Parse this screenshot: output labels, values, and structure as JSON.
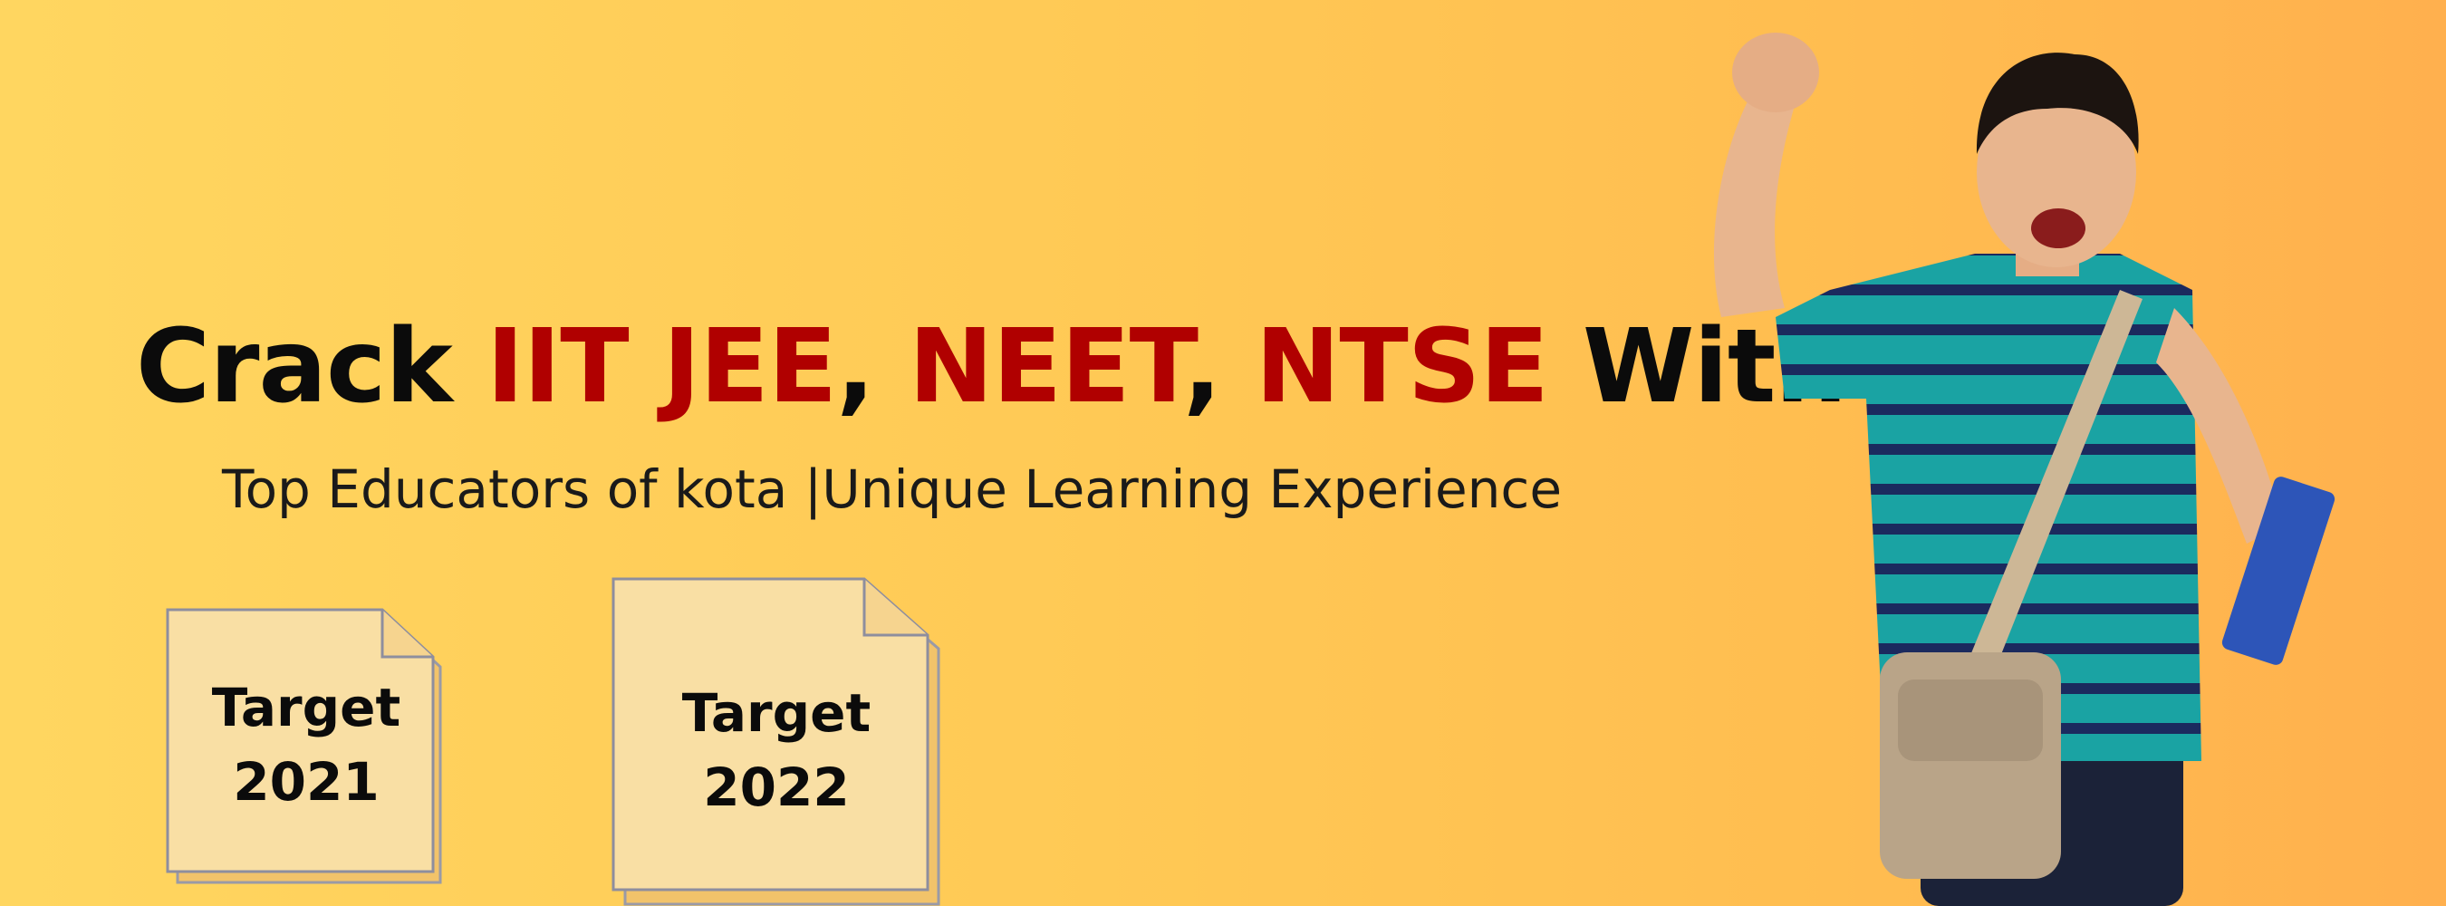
{
  "banner": {
    "headline": {
      "prefix": "Crack ",
      "exam1": "IIT JEE",
      "sep1": ", ",
      "exam2": "NEET",
      "sep2": ", ",
      "exam3": "NTSE",
      "suffix": " With"
    },
    "subline": "Top Educators of kota |Unique Learning Experience",
    "notes": [
      {
        "line1": "Target",
        "line2": "2021"
      },
      {
        "line1": "Target",
        "line2": "2022"
      }
    ],
    "colors": {
      "background_start": "#ffd660",
      "background_end": "#ffb04e",
      "headline": "#0b0b0b",
      "highlight": "#b00000",
      "note_fill": "#f9dfa4",
      "note_back": "#f2c36a"
    },
    "image": "cheering-student-photo"
  }
}
